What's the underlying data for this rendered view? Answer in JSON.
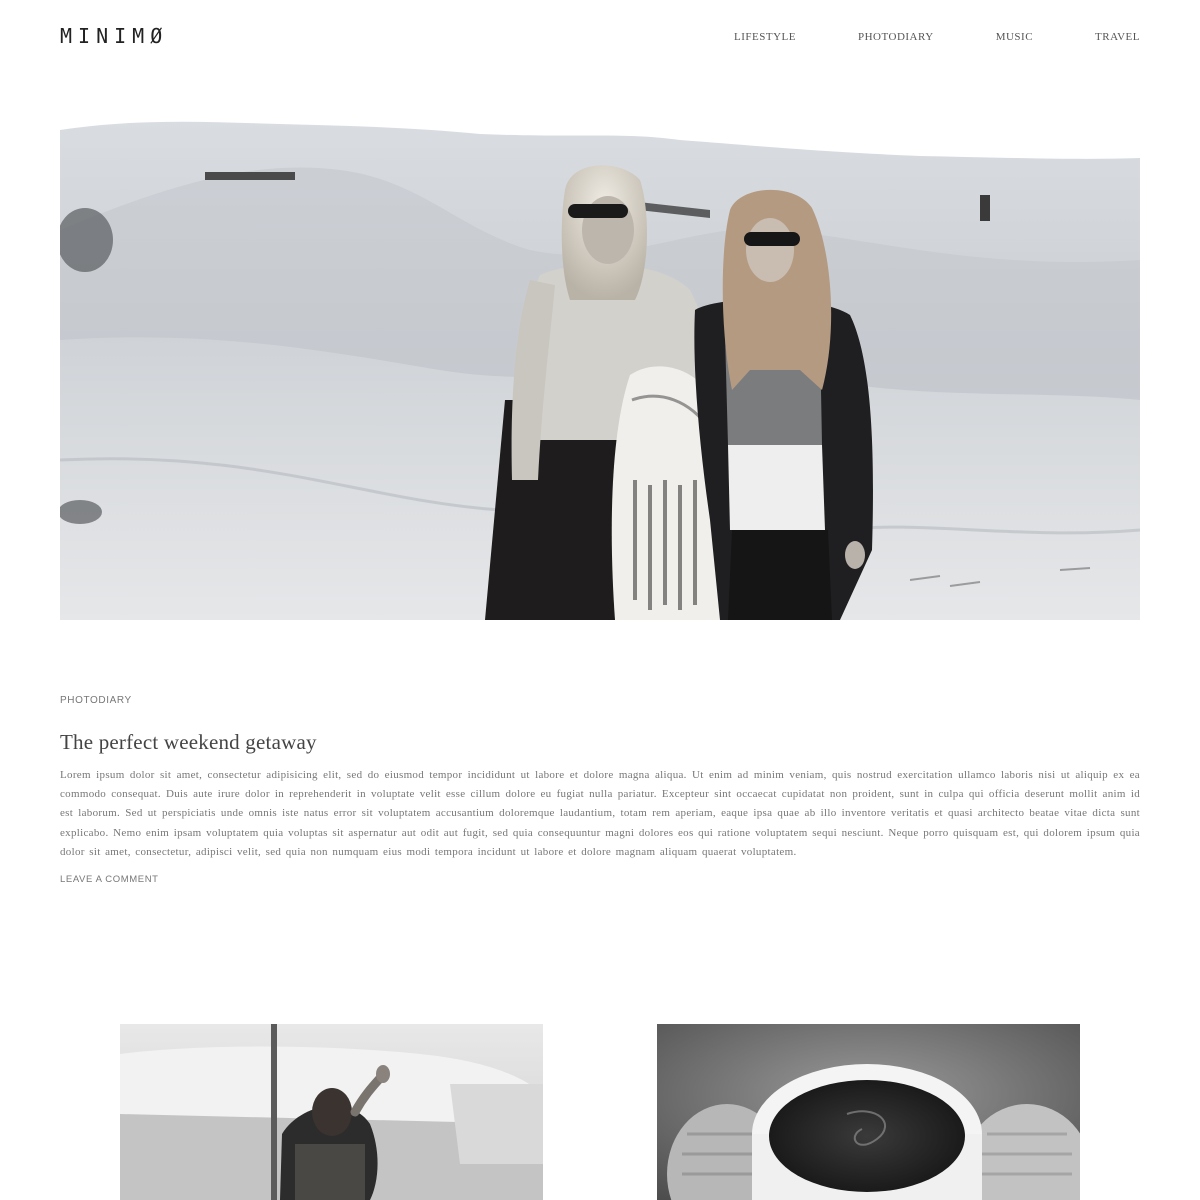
{
  "site": {
    "logo": "MINIMØ"
  },
  "nav": {
    "items": [
      {
        "label": "LIFESTYLE"
      },
      {
        "label": "PHOTODIARY"
      },
      {
        "label": "MUSIC"
      },
      {
        "label": "TRAVEL"
      }
    ]
  },
  "hero": {
    "image": "photo-two-women-in-snowy-landscape"
  },
  "post": {
    "category": "PHOTODIARY",
    "title": "The perfect weekend getaway",
    "excerpt": "Lorem ipsum dolor sit amet, consectetur adipisicing elit, sed do eiusmod tempor incididunt ut labore et dolore magna aliqua. Ut enim ad minim veniam, quis nostrud exercitation ullamco laboris nisi ut aliquip ex ea commodo consequat. Duis aute irure dolor in reprehenderit in voluptate velit esse cillum dolore eu fugiat nulla pariatur. Excepteur sint occaecat cupidatat non proident, sunt in culpa qui officia deserunt mollit anim id est laborum. Sed ut perspiciatis unde omnis iste natus error sit voluptatem accusantium doloremque laudantium, totam rem aperiam, eaque ipsa quae ab illo inventore veritatis et quasi architecto beatae vitae dicta sunt explicabo. Nemo enim ipsam voluptatem quia voluptas sit aspernatur aut odit aut fugit, sed quia consequuntur magni dolores eos qui ratione voluptatem sequi nesciunt. Neque porro quisquam est, qui dolorem ipsum quia dolor sit amet, consectetur, adipisci velit, sed quia non numquam eius modi tempora incidunt ut labore et dolore magnam aliquam quaerat voluptatem.",
    "comment_link": "LEAVE A COMMENT"
  },
  "grid": {
    "items": [
      {
        "image": "photo-woman-outdoors"
      },
      {
        "image": "photo-coffee-cup-knit-mittens"
      }
    ]
  },
  "colors": {
    "background": "#ffffff",
    "text": "#444444",
    "muted": "#777777"
  }
}
